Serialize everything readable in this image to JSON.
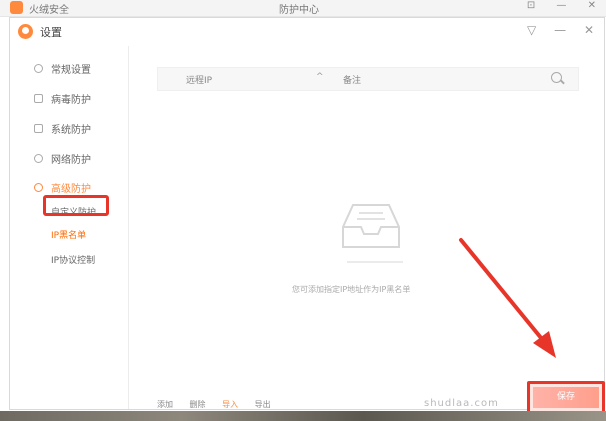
{
  "background_app": {
    "title": "火绒安全",
    "center_title": "防护中心",
    "controls": [
      "⊡",
      "—",
      "✕"
    ]
  },
  "dialog": {
    "title": "设置",
    "controls": [
      "▽",
      "—",
      "✕"
    ]
  },
  "sidebar": {
    "items": [
      {
        "label": "常规设置"
      },
      {
        "label": "病毒防护"
      },
      {
        "label": "系统防护"
      },
      {
        "label": "网络防护"
      },
      {
        "label": "高级防护"
      }
    ],
    "subitems": [
      {
        "label": "自定义防护"
      },
      {
        "label": "IP黑名单"
      },
      {
        "label": "IP协议控制"
      }
    ]
  },
  "table": {
    "col_ip": "远程IP",
    "sort_indicator": "^",
    "col_note": "备注"
  },
  "empty_state": {
    "text": "您可添加指定IP地址作为IP黑名单"
  },
  "footer": {
    "items": [
      "添加",
      "删除",
      "导入",
      "导出"
    ]
  },
  "confirm_button": {
    "label": "保存"
  },
  "watermark": "shudlaa.com",
  "colors": {
    "accent": "#ff8a3d",
    "annotation_red": "#e8352a"
  }
}
